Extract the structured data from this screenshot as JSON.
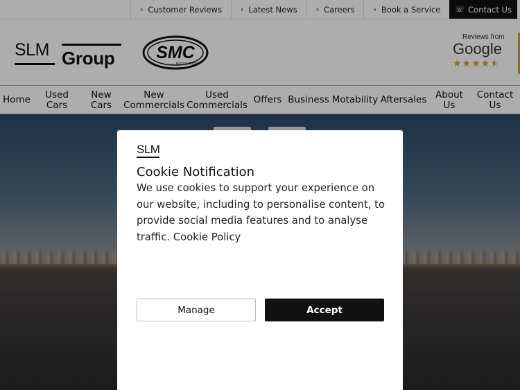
{
  "topbar": {
    "links": [
      {
        "label": "Customer Reviews"
      },
      {
        "label": "Latest News"
      },
      {
        "label": "Careers"
      },
      {
        "label": "Book a Service"
      }
    ],
    "contact_label": "Contact Us"
  },
  "header": {
    "logo_top": "SLM",
    "logo_bottom": "Group",
    "smc_logo_text": "SMC",
    "smc_logo_subtext": "MOTOR GROUP",
    "reviews_from": "Reviews from",
    "reviews_brand": "Google",
    "reviews_rating": 4.5
  },
  "nav": {
    "items": [
      {
        "label": "Home"
      },
      {
        "label": "Used Cars"
      },
      {
        "label": "New Cars"
      },
      {
        "label": "New Commercials"
      },
      {
        "label": "Used Commercials"
      },
      {
        "label": "Offers"
      },
      {
        "label": "Business"
      },
      {
        "label": "Motability"
      },
      {
        "label": "Aftersales"
      },
      {
        "label": "About Us"
      },
      {
        "label": "Contact Us"
      }
    ]
  },
  "modal": {
    "logo": "SLM",
    "title": "Cookie Notification",
    "body": "We use cookies to support your experience on our website, including to personalise content, to provide social media features and to analyse traffic.",
    "policy_link": "Cookie Policy",
    "manage_label": "Manage",
    "accept_label": "Accept"
  },
  "colors": {
    "accent_gold": "#c9a227",
    "dark": "#111111"
  }
}
